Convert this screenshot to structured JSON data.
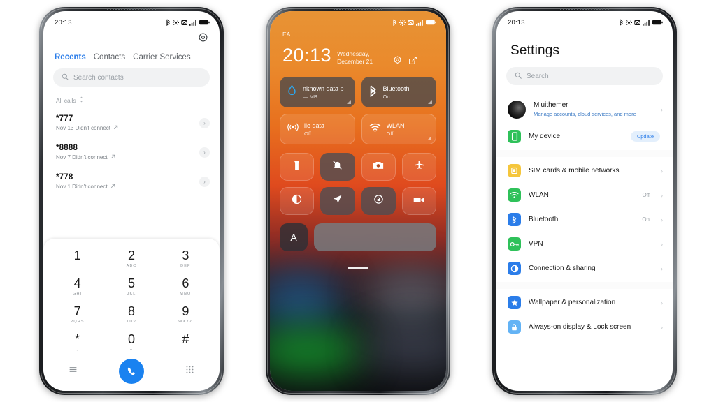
{
  "background_color": "#ffffff",
  "accent_blue": "#2b7de9",
  "phone1": {
    "name": "dialer-app",
    "status_bar": {
      "time": "20:13",
      "icons": [
        "bluetooth-icon",
        "gear-status-icon",
        "mute-icon",
        "signal-bars-icon",
        "battery-icon"
      ]
    },
    "settings_gear": "gear-icon",
    "tabs": [
      {
        "label": "Recents",
        "active": true
      },
      {
        "label": "Contacts",
        "active": false
      },
      {
        "label": "Carrier Services",
        "active": false
      }
    ],
    "search": {
      "placeholder": "Search contacts",
      "value": ""
    },
    "filter": {
      "label": "All calls"
    },
    "calls": [
      {
        "number": "*777",
        "detail": "Nov 13 Didn't connect"
      },
      {
        "number": "*8888",
        "detail": "Nov 7 Didn't connect"
      },
      {
        "number": "*778",
        "detail": "Nov 1 Didn't connect"
      }
    ],
    "keypad": [
      {
        "digit": "1",
        "letters": ""
      },
      {
        "digit": "2",
        "letters": "ABC"
      },
      {
        "digit": "3",
        "letters": "DEF"
      },
      {
        "digit": "4",
        "letters": "GHI"
      },
      {
        "digit": "5",
        "letters": "JKL"
      },
      {
        "digit": "6",
        "letters": "MNO"
      },
      {
        "digit": "7",
        "letters": "PQRS"
      },
      {
        "digit": "8",
        "letters": "TUV"
      },
      {
        "digit": "9",
        "letters": "WXYZ"
      },
      {
        "digit": "*",
        "letters": ","
      },
      {
        "digit": "0",
        "letters": "+"
      },
      {
        "digit": "#",
        "letters": ""
      }
    ],
    "bottom_bar": {
      "menu": "menu-icon",
      "call": "call-icon",
      "keypad": "dialpad-icon"
    }
  },
  "phone2": {
    "name": "control-center",
    "carrier": "EA",
    "status_bar": {
      "time": "",
      "icons": [
        "bluetooth-icon",
        "gear-status-icon",
        "mute-icon",
        "signal-bars-icon",
        "battery-icon"
      ]
    },
    "clock": "20:13",
    "date": "Wednesday, December 21",
    "header_icons": [
      "gear-icon",
      "edit-icon"
    ],
    "big_tiles": [
      {
        "title": "nknown data p",
        "subtitle": "— MB",
        "icon": "data-drop-icon",
        "style": "dark"
      },
      {
        "title": "Bluetooth",
        "subtitle": "On",
        "icon": "bluetooth-icon",
        "style": "dark"
      },
      {
        "title": "ile data",
        "subtitle": "Off",
        "icon": "cell-tower-icon",
        "style": "clear"
      },
      {
        "title": "WLAN",
        "subtitle": "Off",
        "icon": "wifi-icon",
        "style": "clear"
      }
    ],
    "small_tiles": [
      {
        "icon": "flashlight-icon",
        "style": "clear"
      },
      {
        "icon": "bell-mute-icon",
        "style": "dark"
      },
      {
        "icon": "camera-icon",
        "style": "clear"
      },
      {
        "icon": "airplane-icon",
        "style": "clear"
      },
      {
        "icon": "dark-mode-icon",
        "style": "clear"
      },
      {
        "icon": "location-icon",
        "style": "dark"
      },
      {
        "icon": "rotation-lock-icon",
        "style": "dark"
      },
      {
        "icon": "screen-record-icon",
        "style": "clear"
      }
    ],
    "brightness": {
      "auto_label": "A",
      "slider": "brightness-slider"
    }
  },
  "phone3": {
    "name": "settings-app",
    "status_bar": {
      "time": "20:13",
      "icons": [
        "bluetooth-icon",
        "gear-status-icon",
        "mute-icon",
        "signal-bars-icon",
        "battery-icon"
      ]
    },
    "title": "Settings",
    "search": {
      "placeholder": "Search",
      "value": ""
    },
    "groups": [
      {
        "rows": [
          {
            "label": "Miuithemer",
            "sub": "Manage accounts, cloud services, and more",
            "icon": "avatar",
            "value": "",
            "badge": "",
            "chevron": true
          },
          {
            "label": "My device",
            "sub": "",
            "icon": "device-icon",
            "icon_color": "#2fc15a",
            "value": "",
            "badge": "Update",
            "chevron": false
          }
        ]
      },
      {
        "rows": [
          {
            "label": "SIM cards & mobile networks",
            "sub": "",
            "icon": "sim-icon",
            "icon_color": "#f5c63c",
            "value": "",
            "badge": "",
            "chevron": true
          },
          {
            "label": "WLAN",
            "sub": "",
            "icon": "wifi-icon",
            "icon_color": "#2fc15a",
            "value": "Off",
            "badge": "",
            "chevron": true
          },
          {
            "label": "Bluetooth",
            "sub": "",
            "icon": "bluetooth-icon",
            "icon_color": "#2b7de9",
            "value": "On",
            "badge": "",
            "chevron": true
          },
          {
            "label": "VPN",
            "sub": "",
            "icon": "vpn-key-icon",
            "icon_color": "#2fc15a",
            "value": "",
            "badge": "",
            "chevron": true
          },
          {
            "label": "Connection & sharing",
            "sub": "",
            "icon": "connection-icon",
            "icon_color": "#2b7de9",
            "value": "",
            "badge": "",
            "chevron": true
          }
        ]
      },
      {
        "rows": [
          {
            "label": "Wallpaper & personalization",
            "sub": "",
            "icon": "star-icon",
            "icon_color": "#2b7de9",
            "value": "",
            "badge": "",
            "chevron": true
          },
          {
            "label": "Always-on display & Lock screen",
            "sub": "",
            "icon": "lock-icon",
            "icon_color": "#63b3f5",
            "value": "",
            "badge": "",
            "chevron": true
          }
        ]
      }
    ]
  }
}
